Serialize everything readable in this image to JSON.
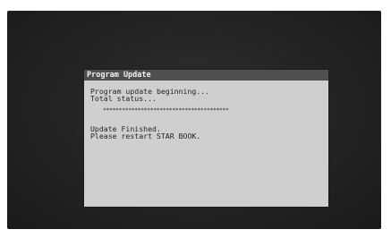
{
  "dialog": {
    "title": "Program Update",
    "lines": [
      "Program update beginning...",
      "Total status..."
    ],
    "progress_text": "****************************************",
    "finished_lines": [
      "Update Finished.",
      "Please restart STAR BOOK."
    ]
  },
  "colors": {
    "screen_background": "#232323",
    "dialog_background": "#cfcfcf",
    "titlebar_background": "#4f4f4f",
    "title_text": "#f2f2f2",
    "body_text": "#262626"
  }
}
